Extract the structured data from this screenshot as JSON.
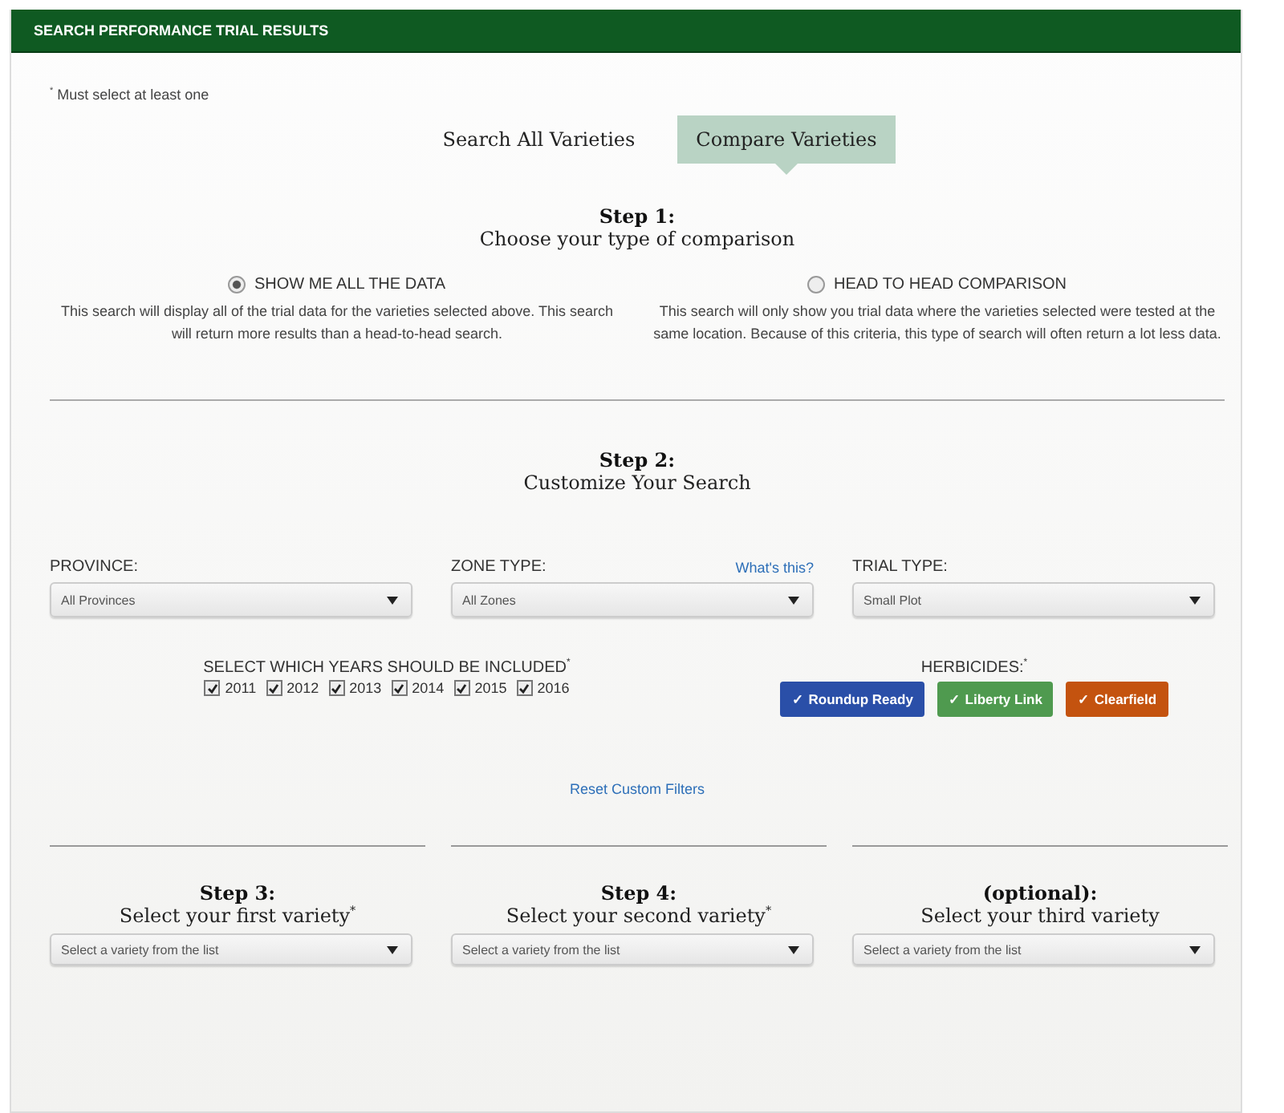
{
  "header": {
    "title": "SEARCH PERFORMANCE TRIAL RESULTS"
  },
  "note": "$^{*}$ Must select at least one",
  "tabs": [
    {
      "label": "Search All Varieties",
      "selected": false
    },
    {
      "label": "Compare Varieties",
      "selected": true
    }
  ],
  "step1": {
    "heading": "Step 1:",
    "subheading": "Choose your type of comparison",
    "options": [
      {
        "label": "SHOW ME ALL THE DATA",
        "selected": true,
        "description": "This search will display all of the trial data for the varieties selected above. This search will return more results than a head-to-head search."
      },
      {
        "label": "HEAD TO HEAD COMPARISON",
        "selected": false,
        "description": "This search will only show you trial data where the varieties selected were tested at the same location. Because of this criteria, this type of search will often return a lot less data."
      }
    ]
  },
  "step2": {
    "heading": "Step 2:",
    "subheading": "Customize Your Search",
    "filters": [
      {
        "label": "PROVINCE:",
        "value": "All Provinces"
      },
      {
        "label": "ZONE TYPE:",
        "value": "All Zones",
        "link": "What's this?"
      },
      {
        "label": "TRIAL TYPE:",
        "value": "Small Plot"
      }
    ],
    "years": {
      "label": "SELECT WHICH YEARS SHOULD BE INCLUDED$^{*}$",
      "items": [
        {
          "label": "2011",
          "checked": true
        },
        {
          "label": "2012",
          "checked": true
        },
        {
          "label": "2013",
          "checked": true
        },
        {
          "label": "2014",
          "checked": true
        },
        {
          "label": "2015",
          "checked": true
        },
        {
          "label": "2016",
          "checked": true
        }
      ]
    },
    "herbicides": {
      "label": "HERBICIDES:$^{*}$",
      "items": [
        {
          "label": "✓ Roundup Ready",
          "checked": true,
          "color": "#2a4fa8"
        },
        {
          "label": "✓ Liberty Link",
          "checked": true,
          "color": "#4f9a4f"
        },
        {
          "label": "✓ Clearfield",
          "checked": true,
          "color": "#c4530f"
        }
      ]
    },
    "reset": "Reset Custom Filters"
  },
  "varieties": [
    {
      "heading": "Step 3:",
      "subheading": "Select your first variety$^{*}$",
      "placeholder": "Select a variety from the list"
    },
    {
      "heading": "Step 4:",
      "subheading": "Select your second variety$^{*}$",
      "placeholder": "Select a variety from the list"
    },
    {
      "heading": "(optional):",
      "subheading": "Select your third variety",
      "placeholder": "Select a variety from the list"
    }
  ]
}
